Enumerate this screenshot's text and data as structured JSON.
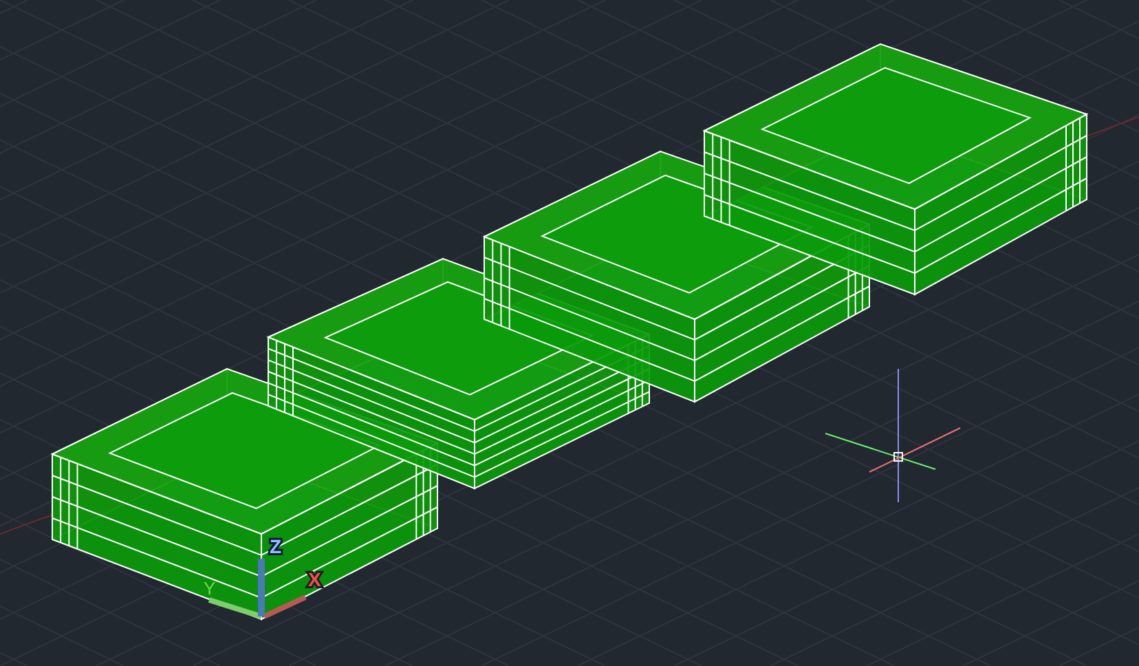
{
  "ucs_icon": {
    "x_label": "X",
    "y_label": "Y",
    "z_label": "Z"
  }
}
